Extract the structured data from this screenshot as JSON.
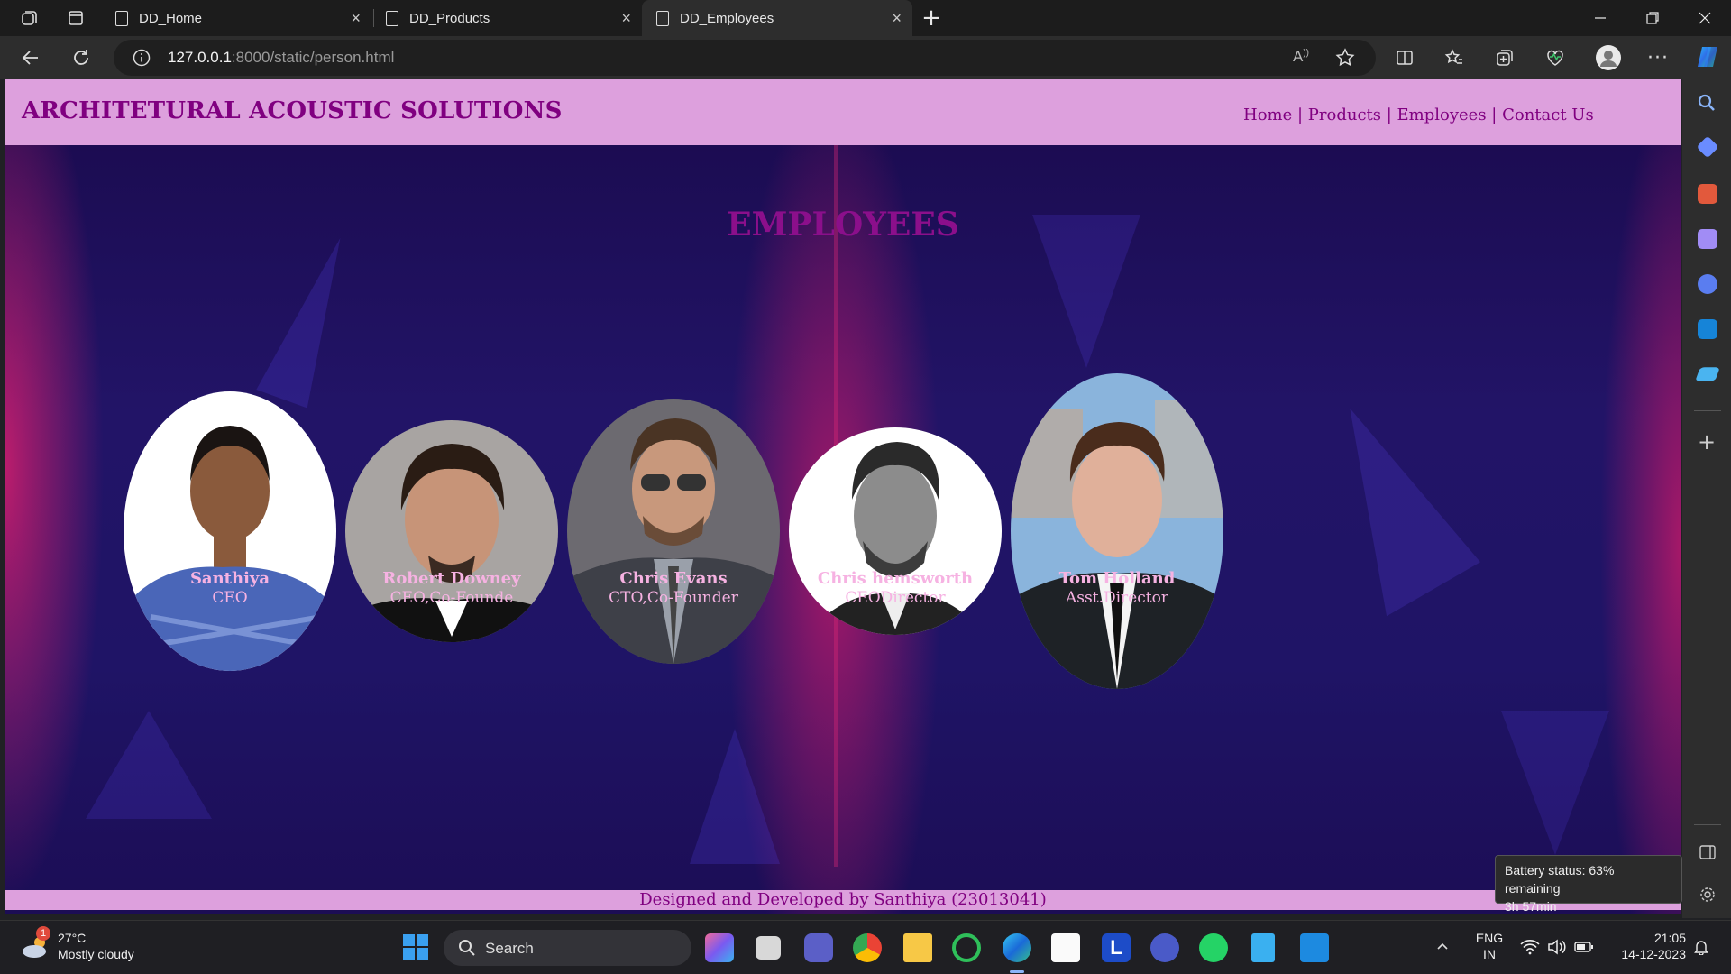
{
  "browser": {
    "tabs": [
      {
        "title": "DD_Home",
        "active": false
      },
      {
        "title": "DD_Products",
        "active": false
      },
      {
        "title": "DD_Employees",
        "active": true
      }
    ],
    "new_tab_glyph": "+",
    "close_glyph": "×",
    "url_host": "127.0.0.1",
    "url_rest": ":8000/static/person.html",
    "icons": [
      "workspaces-icon",
      "tab-actions-icon",
      "back-icon",
      "refresh-icon",
      "site-info-icon",
      "read-aloud-icon",
      "favorite-star-icon",
      "split-screen-icon",
      "favorites-icon",
      "collections-icon",
      "browser-essentials-icon",
      "profile-icon",
      "more-icon",
      "copilot-icon"
    ]
  },
  "site": {
    "brand": "ARCHITETURAL ACOUSTIC SOLUTIONS",
    "nav": [
      {
        "label": "Home"
      },
      {
        "label": "Products"
      },
      {
        "label": "Employees"
      },
      {
        "label": "Contact Us"
      }
    ],
    "nav_separator": " | ",
    "heading": "EMPLOYEES",
    "employees": [
      {
        "name": "Santhiya",
        "role": "CEO"
      },
      {
        "name": "Robert Downey",
        "role": "CEO,Co-Founde"
      },
      {
        "name": "Chris Evans",
        "role": "CTO,Co-Founder"
      },
      {
        "name": "Chris hemsworth",
        "role": "CEODirector"
      },
      {
        "name": "Tom Holland",
        "role": "Asst.Director"
      }
    ],
    "footer": "Designed and Developed by Santhiya (23013041)",
    "colors": {
      "header_bg": "#dda0dd",
      "brand": "#800080",
      "name_text": "#f6b2e2",
      "page_bg": "#221467"
    }
  },
  "tooltip": {
    "line1": "Battery status: 63% remaining",
    "line2": "3h 57min"
  },
  "taskbar": {
    "weather_temp": "27°C",
    "weather_desc": "Mostly cloudy",
    "weather_badge": "1",
    "search_label": "Search",
    "lang_top": "ENG",
    "lang_bottom": "IN",
    "time": "21:05",
    "date": "14-12-2023"
  }
}
